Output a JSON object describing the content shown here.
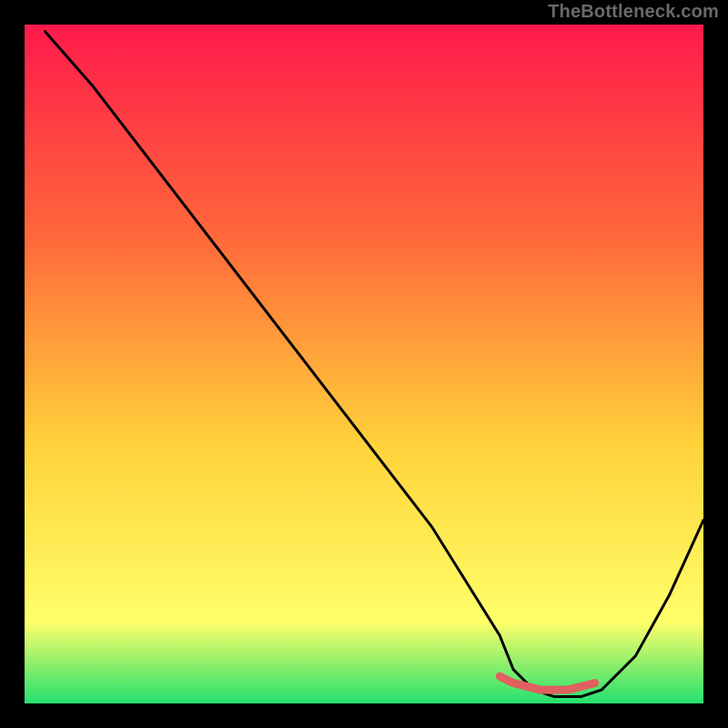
{
  "attribution": "TheBottleneck.com",
  "colors": {
    "frame": "#000000",
    "gradient_top": "#ff1a4b",
    "gradient_mid1": "#ff6a3a",
    "gradient_mid2": "#ffd23a",
    "gradient_bottom1": "#ffff6a",
    "gradient_bottom2": "#24e06e",
    "curve": "#000000",
    "marker": "#e06060"
  },
  "chart_data": {
    "type": "line",
    "title": "",
    "xlabel": "",
    "ylabel": "",
    "xlim": [
      0,
      100
    ],
    "ylim": [
      0,
      100
    ],
    "series": [
      {
        "name": "bottleneck-curve",
        "x": [
          3,
          10,
          20,
          30,
          40,
          50,
          60,
          70,
          72,
          75,
          78,
          82,
          85,
          90,
          95,
          100
        ],
        "y": [
          99,
          91,
          78,
          65,
          52,
          39,
          26,
          10,
          5,
          2,
          1,
          1,
          2,
          7,
          16,
          27
        ]
      }
    ],
    "marker_segment": {
      "name": "optimal-range",
      "x": [
        70,
        72,
        74,
        76,
        78,
        80,
        82,
        84
      ],
      "y": [
        4,
        3,
        2.5,
        2,
        2,
        2,
        2.5,
        3
      ]
    }
  }
}
